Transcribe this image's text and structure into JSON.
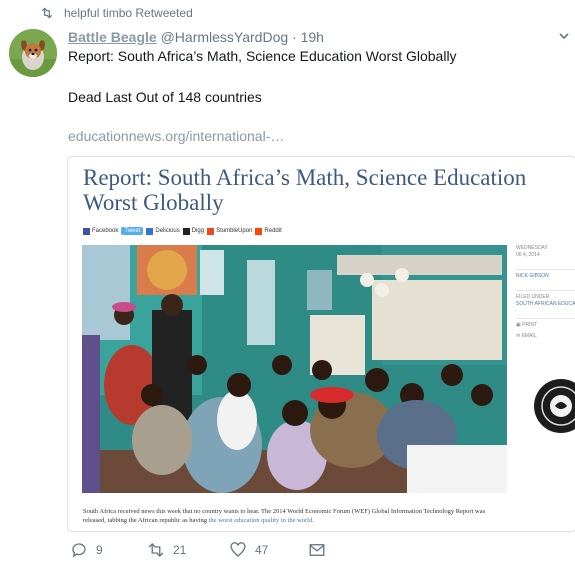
{
  "retweet": {
    "text": "helpful timbo Retweeted"
  },
  "tweet": {
    "name": "Battle Beagle",
    "handle": "@HarmlessYardDog",
    "time": "· 19h",
    "line1": "Report: South Africa’s Math, Science Education Worst Globally",
    "line2": "Dead Last Out of 148 countries",
    "link": "educationnews.org/international-…"
  },
  "card": {
    "title": "Report: South Africa’s Math, Science Education Worst Globally",
    "share": [
      "Facebook",
      "Tweet",
      "Delicious",
      "Digg",
      "StumbleUpon",
      "Reddit"
    ],
    "sidebar": {
      "day": "WEDNESDAY",
      "date": "06 4, 2014",
      "author": "NICK GIBSON",
      "filed": "FILED UNDER",
      "category": "SOUTH AFRICAN EDUCATION",
      "print": "PRINT",
      "email": "EMAIL"
    },
    "caption_pre": "South Africa received news this week that no country wants to hear. The 2014 World Economic Forum (WEF) Global Information Technology Report was released, tabbing the African republic as having ",
    "caption_link": "the worst education quality in the world",
    "caption_post": "."
  },
  "actions": {
    "replies": "9",
    "retweets": "21",
    "likes": "47"
  },
  "colors": {
    "title_blue": "#3d5a80",
    "muted": "#657786",
    "name": "#8a9aa6"
  }
}
